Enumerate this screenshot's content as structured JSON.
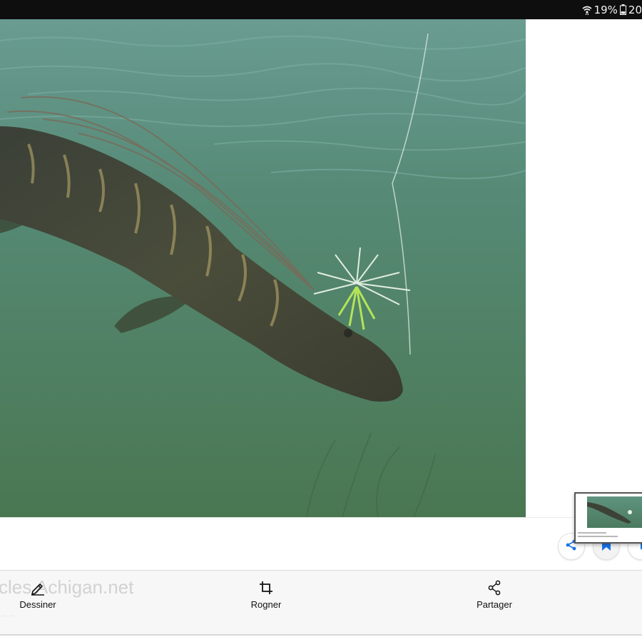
{
  "status_bar": {
    "wifi_icon": "wifi-icon",
    "battery_text": "19%",
    "battery_icon": "battery-icon",
    "time_text": "20"
  },
  "image": {
    "icon": "image-content"
  },
  "background": {
    "ghost_text": "cles Achigan.net",
    "ghost_subtext": "... ..."
  },
  "floating_actions": {
    "share_icon": "share-icon",
    "bookmark_icon": "bookmark-icon"
  },
  "thumbnail": {
    "icon": "screenshot-thumbnail"
  },
  "toolbar": {
    "draw_label": "Dessiner",
    "crop_label": "Rogner",
    "share_label": "Partager"
  },
  "colors": {
    "water": "#4d7a63",
    "status_bar": "#0e0e0e",
    "accent": "#1a73e8"
  }
}
